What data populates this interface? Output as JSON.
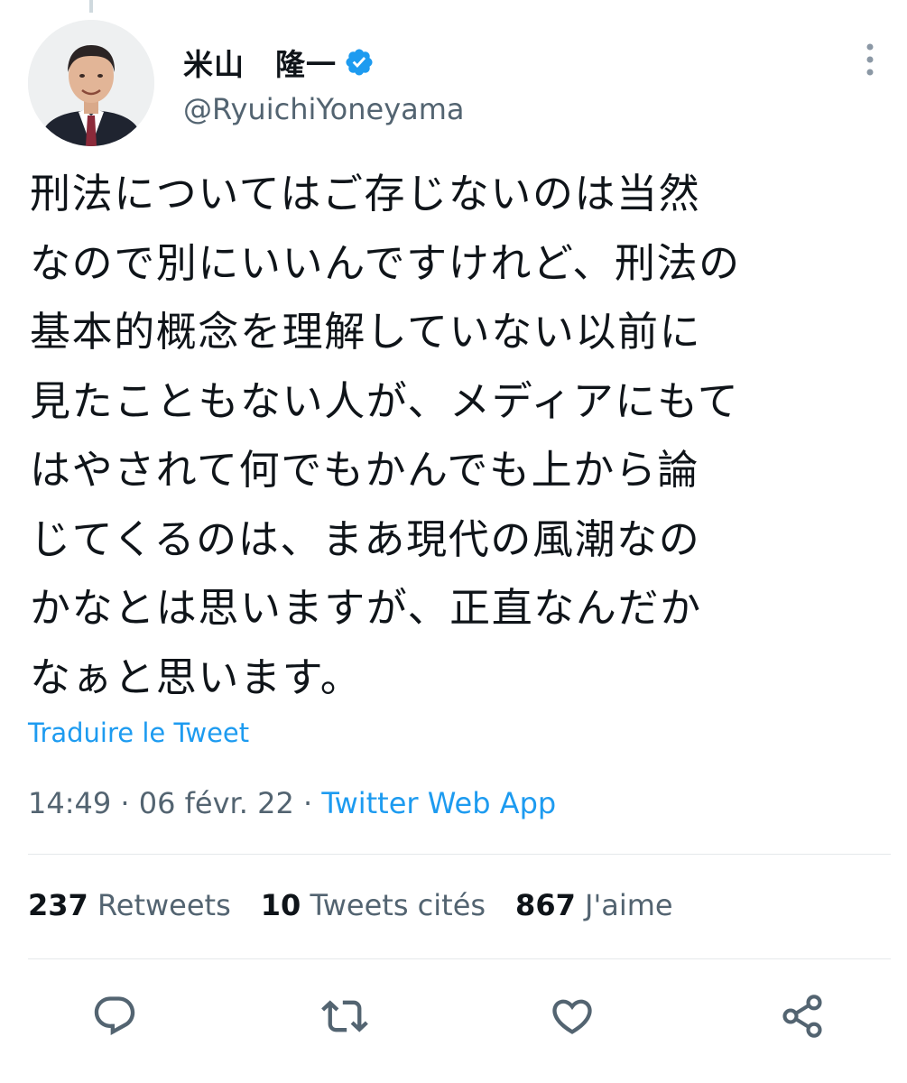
{
  "tweet": {
    "display_name": "米山　隆一",
    "handle": "@RyuichiYoneyama",
    "text_lines": [
      "刑法についてはご存じないのは当然",
      "なので別にいいんですけれど、刑法の",
      "基本的概念を理解していない以前に",
      "見たこともない人が、メディアにもて",
      "はやされて何でもかんでも上から論",
      "じてくるのは、まあ現代の風潮なの",
      "かなとは思いますが、正直なんだか",
      "なぁと思います。"
    ],
    "translate_label": "Traduire le Tweet",
    "time": "14:49",
    "separator": "·",
    "date": "06 févr. 22",
    "source": "Twitter Web App"
  },
  "stats": {
    "retweets_count": "237",
    "retweets_label": "Retweets",
    "quotes_count": "10",
    "quotes_label": "Tweets cités",
    "likes_count": "867",
    "likes_label": "J'aime"
  },
  "icons": {
    "verified": "verified-badge-icon",
    "more": "more-vertical-icon",
    "reply": "reply-icon",
    "retweet": "retweet-icon",
    "like": "like-icon",
    "share": "share-icon"
  },
  "colors": {
    "accent": "#1d9bf0",
    "text": "#0f1419",
    "secondary": "#536471",
    "divider": "#e5e8eb"
  }
}
